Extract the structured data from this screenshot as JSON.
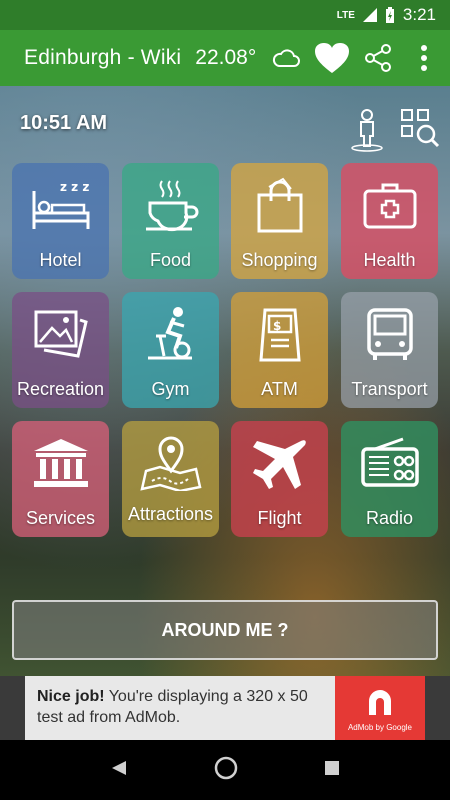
{
  "status_bar": {
    "network": "LTE",
    "time": "3:21"
  },
  "app_bar": {
    "title": "Edinburgh - Wiki",
    "temperature": "22.08°"
  },
  "clock": "10:51 AM",
  "tiles": [
    {
      "label": "Hotel",
      "color": "#4a73b0"
    },
    {
      "label": "Food",
      "color": "#3aa886"
    },
    {
      "label": "Shopping",
      "color": "#d4a542"
    },
    {
      "label": "Health",
      "color": "#d94d63"
    },
    {
      "label": "Recreation",
      "color": "#7a4f86"
    },
    {
      "label": "Gym",
      "color": "#3aa7b0"
    },
    {
      "label": "ATM",
      "color": "#d4a03a"
    },
    {
      "label": "Transport",
      "color": "#9aa2ad"
    },
    {
      "label": "Services",
      "color": "#d9607a"
    },
    {
      "label": "Attractions",
      "color": "#b8a040"
    },
    {
      "label": "Flight",
      "color": "#c7414e"
    },
    {
      "label": "Radio",
      "color": "#2f9060"
    }
  ],
  "around_button": "AROUND ME ?",
  "ad": {
    "bold": "Nice job!",
    "text": "You're displaying a 320 x 50 test ad from AdMob.",
    "caption": "AdMob by Google"
  }
}
